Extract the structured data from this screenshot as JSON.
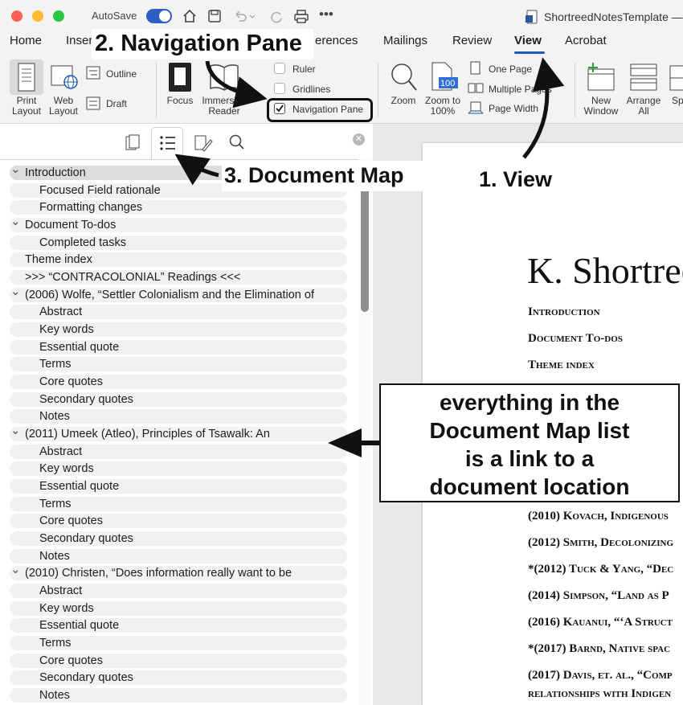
{
  "window": {
    "autosave_label": "AutoSave",
    "title": "ShortreedNotesTemplate —"
  },
  "tabs": [
    "Home",
    "Insert",
    "Mailings",
    "Review",
    "View",
    "Acrobat"
  ],
  "tab_partial": "erences",
  "ribbon": {
    "print_layout": "Print Layout",
    "web_layout": "Web Layout",
    "outline": "Outline",
    "draft": "Draft",
    "focus": "Focus",
    "immersive_reader": "Immersive Reader",
    "ruler": "Ruler",
    "gridlines": "Gridlines",
    "navigation_pane": "Navigation Pane",
    "zoom": "Zoom",
    "zoom_100": "Zoom to 100%",
    "one_page": "One Page",
    "multiple_pages": "Multiple Pages",
    "page_width": "Page Width",
    "new_window": "New Window",
    "arrange_all": "Arrange All",
    "split_partial": "Sp"
  },
  "nav_items": [
    {
      "label": "Introduction",
      "level": 0,
      "chevron": true,
      "selected": true
    },
    {
      "label": "Focused Field rationale",
      "level": 1
    },
    {
      "label": "Formatting changes",
      "level": 1
    },
    {
      "label": "Document To-dos",
      "level": 0,
      "chevron": true
    },
    {
      "label": "Completed tasks",
      "level": 1
    },
    {
      "label": "Theme index",
      "level": 0
    },
    {
      "label": ">>> “CONTRACOLONIAL” Readings <<<",
      "level": 0
    },
    {
      "label": "(2006) Wolfe, “Settler Colonialism and the Elimination of",
      "level": 0,
      "chevron": true
    },
    {
      "label": "Abstract",
      "level": 1
    },
    {
      "label": "Key words",
      "level": 1
    },
    {
      "label": "Essential quote",
      "level": 1
    },
    {
      "label": "Terms",
      "level": 1
    },
    {
      "label": "Core quotes",
      "level": 1
    },
    {
      "label": "Secondary quotes",
      "level": 1
    },
    {
      "label": "Notes",
      "level": 1
    },
    {
      "label": "(2011) Umeek (Atleo), Principles of Tsawalk: An",
      "level": 0,
      "chevron": true
    },
    {
      "label": "Abstract",
      "level": 1
    },
    {
      "label": "Key words",
      "level": 1
    },
    {
      "label": "Essential quote",
      "level": 1
    },
    {
      "label": "Terms",
      "level": 1
    },
    {
      "label": "Core quotes",
      "level": 1
    },
    {
      "label": "Secondary quotes",
      "level": 1
    },
    {
      "label": "Notes",
      "level": 1
    },
    {
      "label": "(2010) Christen, “Does information really want to be",
      "level": 0,
      "chevron": true
    },
    {
      "label": "Abstract",
      "level": 1
    },
    {
      "label": "Key words",
      "level": 1
    },
    {
      "label": "Essential quote",
      "level": 1
    },
    {
      "label": "Terms",
      "level": 1
    },
    {
      "label": "Core quotes",
      "level": 1
    },
    {
      "label": "Secondary quotes",
      "level": 1
    },
    {
      "label": "Notes",
      "level": 1
    }
  ],
  "document": {
    "title": "K. Shortree",
    "headings": [
      "Introduction",
      "Document To-dos",
      "Theme index"
    ],
    "refs": [
      "(2010) Kovach, Indigenous",
      "(2012) Smith, Decolonizing",
      "*(2012) Tuck & Yang, “Dec",
      "(2014) Simpson, “Land as P",
      "(2016) Kauanui, “‘A Struct",
      "*(2017) Barnd, Native spac",
      "(2017) Davis, et. al., “Comp"
    ],
    "ref_last_line": "relationships with Indigen"
  },
  "annotations": {
    "step1": "1. View",
    "step2": "2. Navigation Pane",
    "step3": "3. Document Map",
    "callout": [
      "everything in the",
      "Document Map list",
      "is a link to a",
      "document location"
    ]
  },
  "colors": {
    "accent": "#1f5bb5",
    "toggle": "#2c5ec4"
  }
}
